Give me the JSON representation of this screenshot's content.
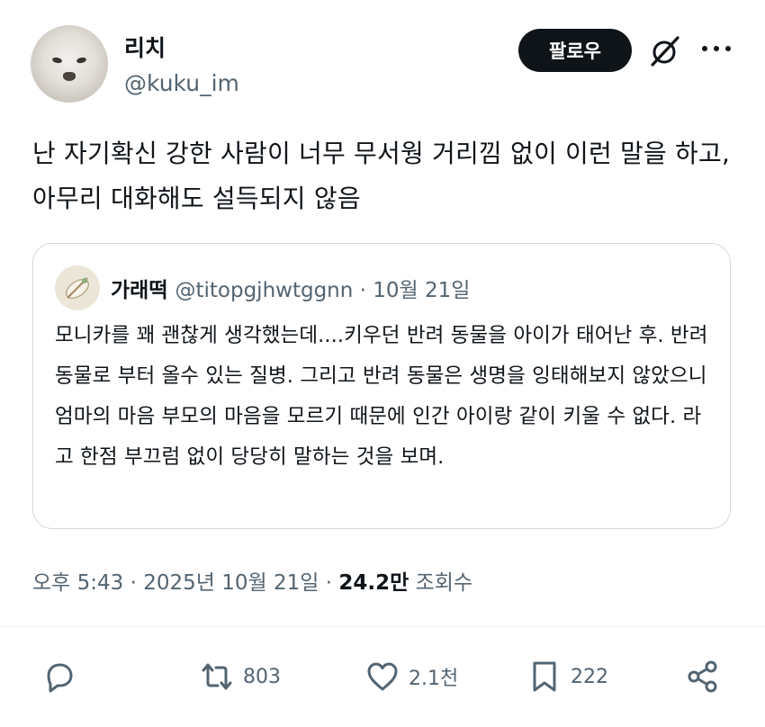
{
  "author": {
    "display_name": "리치",
    "handle": "@kuku_im"
  },
  "header": {
    "follow_label": "팔로우",
    "icons": [
      "grok-icon",
      "more-icon"
    ]
  },
  "tweet": {
    "text": "난 자기확신 강한 사람이 너무 무서웡 거리낌 없이 이런 말을 하고, 아무리 대화해도 설득되지 않음"
  },
  "quote": {
    "display_name": "가래떡",
    "handle": "@titopgjhwtggnn",
    "date": "10월 21일",
    "text": "모니카를 꽤 괜찮게 생각했는데....키우던 반려 동물을 아이가 태어난 후. 반려동물로 부터 올수 있는 질병. 그리고 반려 동물은 생명을 잉태해보지 않았으니 엄마의 마음 부모의 마음을 모르기 때문에 인간 아이랑 같이 키울 수 없다. 라고 한점 부끄럼 없이 당당히 말하는 것을 보며."
  },
  "meta": {
    "time": "오후 5:43",
    "date": "2025년 10월 21일",
    "views": "24.2만",
    "views_label": "조회수"
  },
  "actions": {
    "reply_count": "",
    "retweet_count": "803",
    "like_count": "2.1천",
    "bookmark_count": "222"
  },
  "colors": {
    "text": "#0f1419",
    "secondary": "#536471",
    "border": "#cfd9de",
    "button_bg": "#0f1419"
  }
}
